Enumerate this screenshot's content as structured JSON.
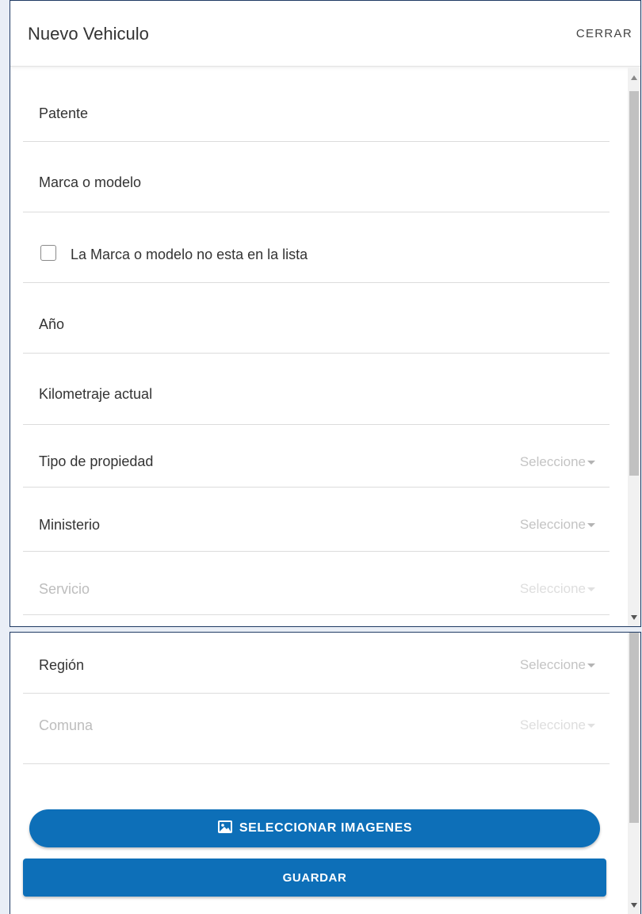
{
  "modal": {
    "title": "Nuevo Vehiculo",
    "close_label": "CERRAR"
  },
  "form": {
    "patente": {
      "label": "Patente"
    },
    "marca": {
      "label": "Marca o modelo"
    },
    "marca_checkbox": {
      "label": "La Marca o modelo no esta en la lista",
      "checked": false
    },
    "anio": {
      "label": "Año"
    },
    "kilometraje": {
      "label": "Kilometraje actual"
    },
    "tipo_propiedad": {
      "label": "Tipo de propiedad",
      "value": "Seleccione"
    },
    "ministerio": {
      "label": "Ministerio",
      "value": "Seleccione"
    },
    "servicio": {
      "label": "Servicio",
      "value": "Seleccione",
      "disabled": true
    },
    "region": {
      "label": "Región",
      "value": "Seleccione"
    },
    "comuna": {
      "label": "Comuna",
      "value": "Seleccione",
      "disabled": true
    }
  },
  "buttons": {
    "select_images": {
      "label": "SELECCIONAR IMAGENES",
      "icon": "image-icon"
    },
    "save": {
      "label": "GUARDAR"
    }
  },
  "colors": {
    "primary": "#0d6fb8",
    "frame_border": "#1f3a63",
    "placeholder": "#c4c4c4"
  }
}
